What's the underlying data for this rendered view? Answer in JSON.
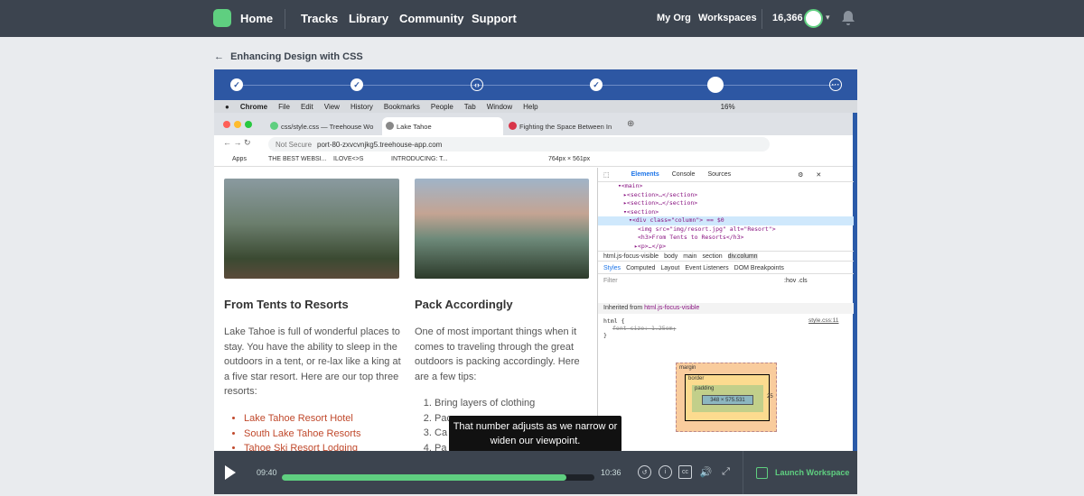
{
  "header": {
    "home": "Home",
    "nav": [
      "Tracks",
      "Library",
      "Community",
      "Support"
    ],
    "my_org": "My Org",
    "workspaces": "Workspaces",
    "points": "16,366"
  },
  "breadcrumb": "Enhancing Design with CSS",
  "mac_menu": [
    "Chrome",
    "File",
    "Edit",
    "View",
    "History",
    "Bookmarks",
    "People",
    "Tab",
    "Window",
    "Help"
  ],
  "mac_status": "16%",
  "browser": {
    "tabs": [
      "css/style.css — Treehouse Wo",
      "Lake Tahoe",
      "Fighting the Space Between In"
    ],
    "security": "Not Secure",
    "url": "port-80-zxvcvnjkg5.treehouse-app.com",
    "bookmarks": [
      "Apps",
      "THE BEST WEBSI...",
      "ILOVE<>S",
      "INTRODUCING: T..."
    ],
    "viewport_size": "764px × 561px"
  },
  "page": {
    "col1_title": "From Tents to Resorts",
    "col1_text": "Lake Tahoe is full of wonderful places to stay. You have the ability to sleep in the outdoors in a tent, or re-lax like a king at a five star resort. Here are our top three resorts:",
    "col1_links": [
      "Lake Tahoe Resort Hotel",
      "South Lake Tahoe Resorts",
      "Tahoe Ski Resort Lodging"
    ],
    "col2_title": "Pack Accordingly",
    "col2_text": "One of most important things when it comes to traveling through the great outdoors is packing accordingly. Here are a few tips:",
    "col2_list": [
      "Bring layers of clothing",
      "Pac",
      "Ca",
      "Pa"
    ]
  },
  "devtools": {
    "tabs": [
      "Elements",
      "Console",
      "Sources"
    ],
    "code": [
      "▾<main>",
      "▸<section>…</section>",
      "▸<section>…</section>",
      "▾<section>",
      "▾<div class=\"column\"> == $0",
      "<img src=\"img/resort.jpg\" alt=\"Resort\">",
      "<h3>From Tents to Resorts</h3>",
      "▸<p>…</p>"
    ],
    "crumbs": [
      "html.js-focus-visible",
      "body",
      "main",
      "section",
      "div.column"
    ],
    "style_tabs": [
      "Styles",
      "Computed",
      "Layout",
      "Event Listeners",
      "DOM Breakpoints"
    ],
    "filter": "Filter",
    "hov": ":hov .cls",
    "inherited_label": "Inherited from",
    "inherited_from": "html.js-focus-visible",
    "rule_selector": "html {",
    "rule_prop": "font-size: 1.25em;",
    "rule_source": "style.css:11",
    "box_margin": "margin",
    "box_border": "border",
    "box_padding": "padding",
    "box_content": "348 × 575.531",
    "box_dash": "-",
    "box_right": "25"
  },
  "caption": "That number adjusts as we narrow or widen our viewpoint.",
  "player": {
    "current_time": "09:40",
    "total_time": "10:36",
    "progress": 0.91,
    "launch": "Launch Workspace"
  }
}
